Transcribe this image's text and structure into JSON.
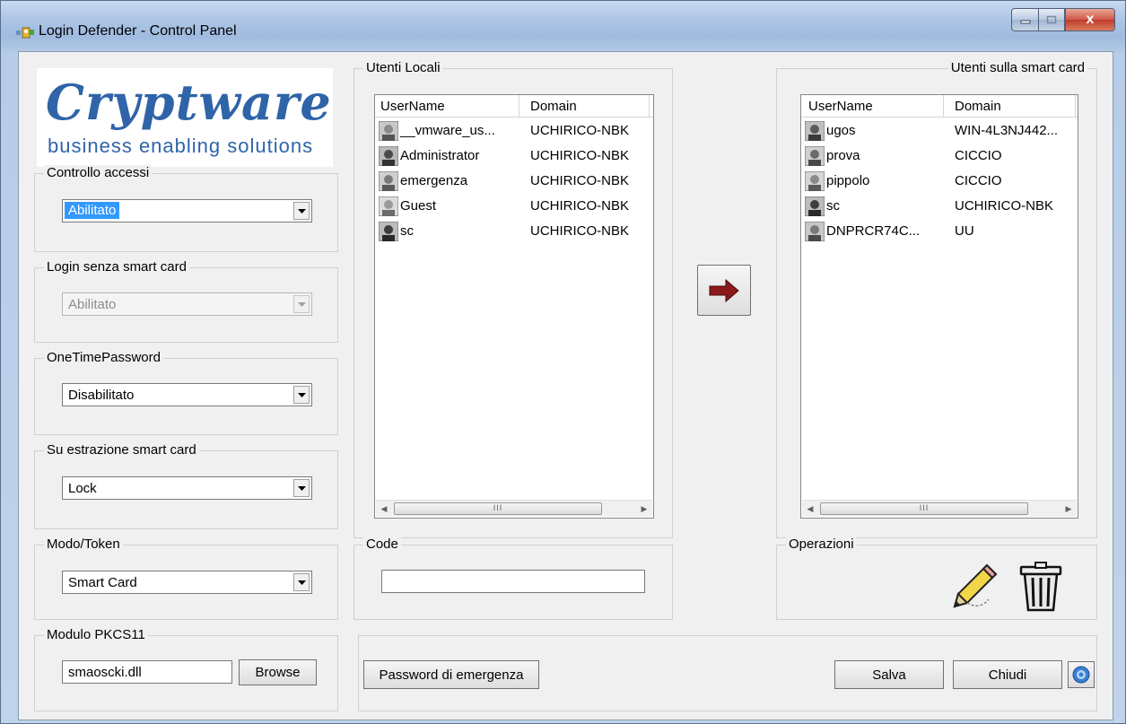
{
  "window": {
    "title": "Login Defender - Control Panel",
    "close_glyph": "x"
  },
  "logo": {
    "brand": "Cryptware",
    "tagline": "business enabling solutions"
  },
  "controllo_accessi": {
    "label": "Controllo accessi",
    "value": "Abilitato"
  },
  "login_senza_smart_card": {
    "label": "Login senza smart card",
    "value": "Abilitato"
  },
  "otp": {
    "label": "OneTimePassword",
    "value": "Disabilitato"
  },
  "estrazione": {
    "label": "Su estrazione smart card",
    "value": "Lock"
  },
  "modo_token": {
    "label": "Modo/Token",
    "value": "Smart Card"
  },
  "pkcs11": {
    "label": "Modulo PKCS11",
    "value": "smaoscki.dll",
    "browse_label": "Browse"
  },
  "utenti_locali": {
    "label": "Utenti Locali",
    "columns": [
      "UserName",
      "Domain"
    ],
    "rows": [
      {
        "username": "__vmware_us...",
        "domain": "UCHIRICO-NBK"
      },
      {
        "username": "Administrator",
        "domain": "UCHIRICO-NBK"
      },
      {
        "username": "emergenza",
        "domain": "UCHIRICO-NBK"
      },
      {
        "username": "Guest",
        "domain": "UCHIRICO-NBK"
      },
      {
        "username": "sc",
        "domain": "UCHIRICO-NBK"
      }
    ]
  },
  "utenti_smart_card": {
    "label": "Utenti sulla smart card",
    "columns": [
      "UserName",
      "Domain"
    ],
    "rows": [
      {
        "username": "ugos",
        "domain": "WIN-4L3NJ442..."
      },
      {
        "username": "prova",
        "domain": "CICCIO"
      },
      {
        "username": "pippolo",
        "domain": "CICCIO"
      },
      {
        "username": "sc",
        "domain": "UCHIRICO-NBK"
      },
      {
        "username": "DNPRCR74C...",
        "domain": "UU"
      }
    ]
  },
  "scrollbar": {
    "thumb_grip": "III"
  },
  "code": {
    "label": "Code",
    "value": ""
  },
  "operazioni": {
    "label": "Operazioni"
  },
  "buttons": {
    "password_emergenza": "Password di emergenza",
    "salva": "Salva",
    "chiudi": "Chiudi"
  },
  "icons": {
    "transfer": "arrow-right-icon",
    "edit": "pencil-icon",
    "delete": "trash-icon",
    "help": "help-icon"
  },
  "colors": {
    "selection": "#3399ff",
    "arrow": "#8b1a1a",
    "brand_blue": "#2f64a8",
    "brand_orange": "#f08a1c"
  }
}
